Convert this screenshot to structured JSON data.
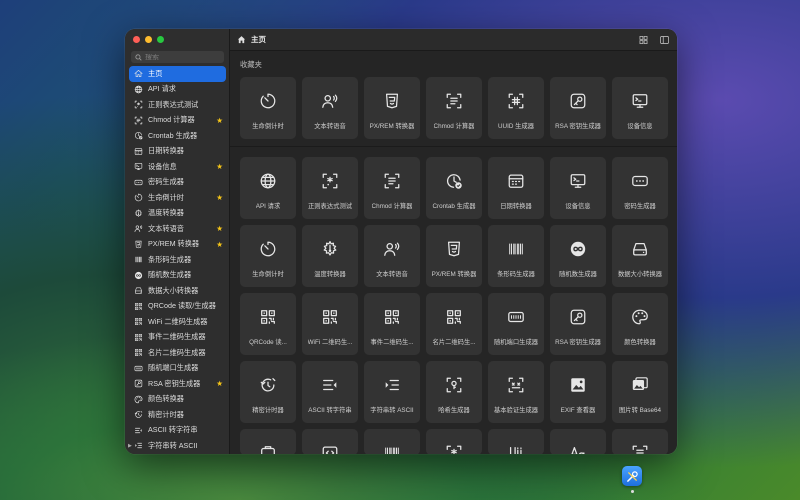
{
  "search": {
    "placeholder": "搜索"
  },
  "header": {
    "title": "主页"
  },
  "sections": {
    "favorites": "收藏夹"
  },
  "sidebar": {
    "items": [
      {
        "label": "主页",
        "icon": "home-icon",
        "active": true,
        "star": false
      },
      {
        "label": "API 请求",
        "icon": "globe-icon",
        "star": false
      },
      {
        "label": "正则表达式测试",
        "icon": "regex-icon",
        "star": false
      },
      {
        "label": "Chmod 计算器",
        "icon": "chmod-icon",
        "star": true
      },
      {
        "label": "Crontab 生成器",
        "icon": "clock-check-icon",
        "star": false
      },
      {
        "label": "日期转换器",
        "icon": "calendar-icon",
        "star": false
      },
      {
        "label": "设备信息",
        "icon": "monitor-icon",
        "star": true
      },
      {
        "label": "密码生成器",
        "icon": "password-icon",
        "star": false
      },
      {
        "label": "生命倒计时",
        "icon": "timer-icon",
        "star": true
      },
      {
        "label": "温度转换器",
        "icon": "thermometer-icon",
        "star": false
      },
      {
        "label": "文本转语音",
        "icon": "speaker-person-icon",
        "star": true
      },
      {
        "label": "PX/REM 转换器",
        "icon": "css-icon",
        "star": true
      },
      {
        "label": "条形码生成器",
        "icon": "barcode-icon",
        "star": false
      },
      {
        "label": "随机数生成器",
        "icon": "infinity-icon",
        "star": false
      },
      {
        "label": "数据大小转换器",
        "icon": "disk-icon",
        "star": false
      },
      {
        "label": "QRCode 读取/生成器",
        "icon": "qrcode-icon",
        "star": false
      },
      {
        "label": "WiFi 二维码生成器",
        "icon": "qrcode-icon",
        "star": false
      },
      {
        "label": "事件二维码生成器",
        "icon": "qrcode-icon",
        "star": false
      },
      {
        "label": "名片二维码生成器",
        "icon": "qrcode-icon",
        "star": false
      },
      {
        "label": "随机端口生成器",
        "icon": "port-icon",
        "star": false
      },
      {
        "label": "RSA 密钥生成器",
        "icon": "key-icon",
        "star": true
      },
      {
        "label": "颜色转换器",
        "icon": "palette-icon",
        "star": false
      },
      {
        "label": "精密计时器",
        "icon": "stopwatch-icon",
        "star": false
      },
      {
        "label": "ASCII 转字符串",
        "icon": "ascii-icon",
        "star": false
      },
      {
        "label": "字符串转 ASCII",
        "icon": "string-ascii-icon",
        "star": false,
        "chevron": true
      }
    ]
  },
  "favorites": [
    {
      "label": "生命倒计时",
      "icon": "timer-icon"
    },
    {
      "label": "文本转语音",
      "icon": "speaker-person-icon"
    },
    {
      "label": "PX/REM 转换器",
      "icon": "css-icon"
    },
    {
      "label": "Chmod 计算器",
      "icon": "chmod-icon"
    },
    {
      "label": "UUID 生成器",
      "icon": "uuid-icon"
    },
    {
      "label": "RSA 密钥生成器",
      "icon": "key-icon"
    },
    {
      "label": "设备信息",
      "icon": "monitor-icon"
    }
  ],
  "tools": [
    {
      "label": "API 请求",
      "icon": "globe-icon"
    },
    {
      "label": "正则表达式测试",
      "icon": "regex-icon"
    },
    {
      "label": "Chmod 计算器",
      "icon": "chmod-icon"
    },
    {
      "label": "Crontab 生成器",
      "icon": "clock-check-icon"
    },
    {
      "label": "日期转换器",
      "icon": "calendar-icon"
    },
    {
      "label": "设备信息",
      "icon": "monitor-icon"
    },
    {
      "label": "密码生成器",
      "icon": "password-icon"
    },
    {
      "label": "生命倒计时",
      "icon": "timer-icon"
    },
    {
      "label": "温度转换器",
      "icon": "thermometer-icon"
    },
    {
      "label": "文本转语音",
      "icon": "speaker-person-icon"
    },
    {
      "label": "PX/REM 转换器",
      "icon": "css-icon"
    },
    {
      "label": "条形码生成器",
      "icon": "barcode-icon"
    },
    {
      "label": "随机数生成器",
      "icon": "infinity-icon"
    },
    {
      "label": "数据大小转换器",
      "icon": "disk-icon"
    },
    {
      "label": "QRCode 读...",
      "icon": "qrcode-icon"
    },
    {
      "label": "WiFi 二维码生...",
      "icon": "qrcode-icon"
    },
    {
      "label": "事件二维码生...",
      "icon": "qrcode-icon"
    },
    {
      "label": "名片二维码生...",
      "icon": "qrcode-icon"
    },
    {
      "label": "随机端口生成器",
      "icon": "port-icon"
    },
    {
      "label": "RSA 密钥生成器",
      "icon": "key-icon"
    },
    {
      "label": "颜色转换器",
      "icon": "palette-icon"
    },
    {
      "label": "精密计时器",
      "icon": "stopwatch-icon"
    },
    {
      "label": "ASCII 转字符串",
      "icon": "ascii-icon"
    },
    {
      "label": "字符串转 ASCII",
      "icon": "string-ascii-icon"
    },
    {
      "label": "哈希生成器",
      "icon": "hash-lock-icon"
    },
    {
      "label": "基本验证生成器",
      "icon": "auth-icon"
    },
    {
      "label": "EXIF 查看器",
      "icon": "photo-icon"
    },
    {
      "label": "图片转 Base64",
      "icon": "image-base64-icon"
    },
    {
      "label": "",
      "icon": "tool-icon"
    },
    {
      "label": "",
      "icon": "code-window-icon"
    },
    {
      "label": "",
      "icon": "barcode-icon"
    },
    {
      "label": "",
      "icon": "regex-icon"
    },
    {
      "label": "",
      "icon": "unicode-icon"
    },
    {
      "label": "",
      "icon": "font-icon"
    },
    {
      "label": "",
      "icon": "text-convert-icon"
    }
  ],
  "colors": {
    "accent": "#1f6ce0",
    "star": "#f5c518",
    "tile": "#333333"
  }
}
